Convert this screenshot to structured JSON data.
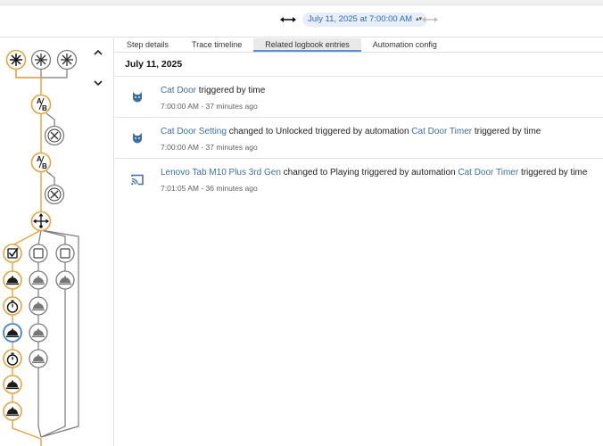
{
  "header": {
    "date_range_label": "July 11, 2025 at 7:00:00 AM",
    "icons": [
      "double-arrow-icon",
      "double-arrow-disabled-icon",
      "chevron-up-down-icon"
    ]
  },
  "trace_graph": {
    "collapse_icons": [
      "chevron-up-icon",
      "chevron-down-icon"
    ],
    "node_icons": [
      "trigger-asterisk-icon",
      "condition-ab-icon",
      "stop-x-icon",
      "choose-branch-icon",
      "checkbox-icon",
      "service-call-icon",
      "delay-timer-icon"
    ],
    "colors": {
      "active": "#e8a33d",
      "inactive": "#7a7a7a",
      "highlight": "#3f86d6"
    }
  },
  "tabs": [
    {
      "label": "Step details"
    },
    {
      "label": "Trace timeline"
    },
    {
      "label": "Related logbook entries"
    },
    {
      "label": "Automation config"
    }
  ],
  "logbook": {
    "date": "July 11, 2025",
    "entries": [
      {
        "icon": "cat-icon",
        "name": "Cat Door",
        "text": " triggered by time",
        "meta": "7:00:00 AM - 37 minutes ago"
      },
      {
        "icon": "cat-icon",
        "name": "Cat Door Setting",
        "text": " changed to Unlocked triggered by automation ",
        "link2": "Cat Door Timer",
        "text2": " triggered by time",
        "meta": "7:00:00 AM - 37 minutes ago"
      },
      {
        "icon": "cast-icon",
        "name": "Lenovo Tab M10 Plus 3rd Gen",
        "text": " changed to Playing triggered by automation ",
        "link2": "Cat Door Timer",
        "text2": " triggered by time",
        "meta": "7:01:05 AM - 36 minutes ago"
      }
    ]
  }
}
